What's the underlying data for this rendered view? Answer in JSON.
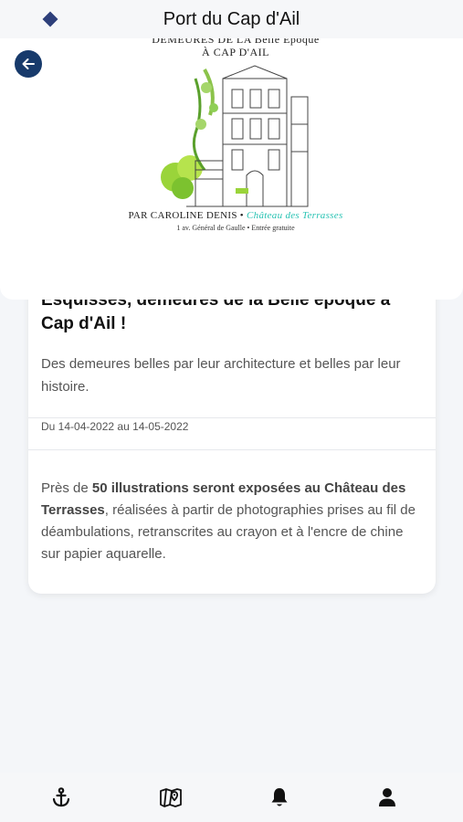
{
  "header": {
    "title": "Port du Cap d'Ail"
  },
  "poster": {
    "heading_line1": "DEMEURES DE LA Belle Époque",
    "heading_line2": "À CAP D'AIL",
    "credit_prefix": "PAR CAROLINE DENIS •",
    "credit_place": "Château des Terrasses",
    "address": "1 av. Général de Gaulle • Entrée gratuite"
  },
  "event": {
    "title": "Esquisses, demeures de la Belle époque  à Cap d'Ail !",
    "lead": "Des demeures belles par leur architecture et belles par leur histoire.",
    "dates": "Du 14-04-2022 au 14-05-2022",
    "body_pre": "Près de ",
    "body_bold": "50 illustrations seront exposées au Château des Terrasses",
    "body_post": ", réalisées à partir de photographies prises au fil de déambulations, retranscrites au crayon et à l'encre de chine sur papier aquarelle."
  },
  "tabs": [
    {
      "icon": "anchor-icon"
    },
    {
      "icon": "map-icon"
    },
    {
      "icon": "bell-icon"
    },
    {
      "icon": "user-icon"
    }
  ],
  "colors": {
    "accent": "#173a6b",
    "logo": "#2d3f7a",
    "teal": "#27c3b3",
    "background": "#f4f6f9"
  }
}
